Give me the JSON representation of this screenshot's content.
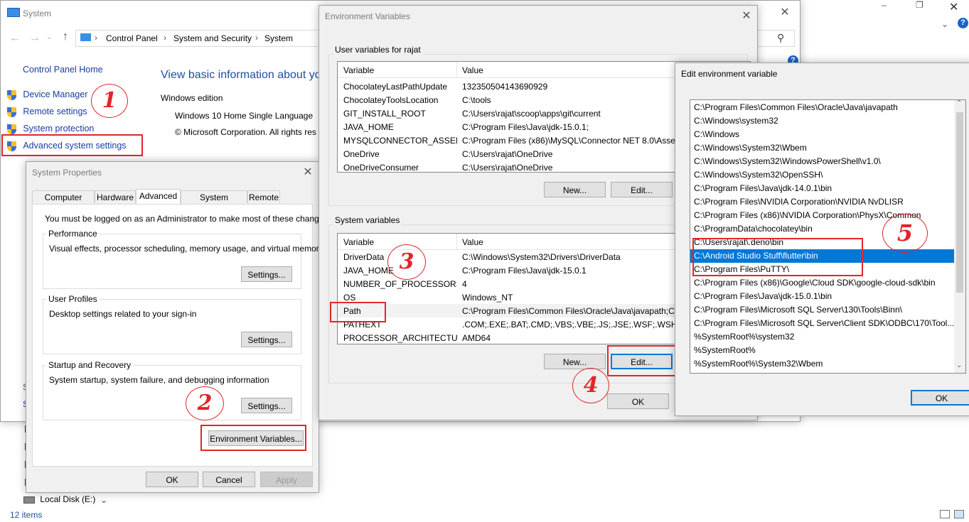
{
  "system_window": {
    "title": "System",
    "breadcrumb": [
      "Control Panel",
      "System and Security",
      "System"
    ],
    "sidebar_home": "Control Panel Home",
    "sidebar_items": [
      "Device Manager",
      "Remote settings",
      "System protection",
      "Advanced system settings"
    ],
    "main_heading": "View basic information about yo",
    "windows_edition_label": "Windows edition",
    "edition_value": "Windows 10 Home Single Language",
    "copyright": "© Microsoft Corporation. All rights res",
    "partial_letters": [
      "S",
      "S"
    ]
  },
  "explorer": {
    "drive_label": "Local Disk (E:)",
    "status_items": "12 items"
  },
  "system_properties": {
    "title": "System Properties",
    "tabs": [
      "Computer Name",
      "Hardware",
      "Advanced",
      "System Protection",
      "Remote"
    ],
    "active_tab": "Advanced",
    "admin_note": "You must be logged on as an Administrator to make most of these changes.",
    "performance": {
      "label": "Performance",
      "desc": "Visual effects, processor scheduling, memory usage, and virtual memory",
      "button": "Settings..."
    },
    "user_profiles": {
      "label": "User Profiles",
      "desc": "Desktop settings related to your sign-in",
      "button": "Settings..."
    },
    "startup": {
      "label": "Startup and Recovery",
      "desc": "System startup, system failure, and debugging information",
      "button": "Settings..."
    },
    "env_button": "Environment Variables...",
    "ok": "OK",
    "cancel": "Cancel",
    "apply": "Apply"
  },
  "env_vars": {
    "title": "Environment Variables",
    "user_group": "User variables for rajat",
    "system_group": "System variables",
    "col_variable": "Variable",
    "col_value": "Value",
    "user_rows": [
      {
        "name": "ChocolateyLastPathUpdate",
        "value": "132350504143690929"
      },
      {
        "name": "ChocolateyToolsLocation",
        "value": "C:\\tools"
      },
      {
        "name": "GIT_INSTALL_ROOT",
        "value": "C:\\Users\\rajat\\scoop\\apps\\git\\current"
      },
      {
        "name": "JAVA_HOME",
        "value": "C:\\Program Files\\Java\\jdk-15.0.1;"
      },
      {
        "name": "MYSQLCONNECTOR_ASSEM...",
        "value": "C:\\Program Files (x86)\\MySQL\\Connector NET 8.0\\Assem"
      },
      {
        "name": "OneDrive",
        "value": "C:\\Users\\rajat\\OneDrive"
      },
      {
        "name": "OneDriveConsumer",
        "value": "C:\\Users\\rajat\\OneDrive"
      }
    ],
    "system_rows": [
      {
        "name": "DriverData",
        "value": "C:\\Windows\\System32\\Drivers\\DriverData"
      },
      {
        "name": "JAVA_HOME",
        "value": "C:\\Program Files\\Java\\jdk-15.0.1"
      },
      {
        "name": "NUMBER_OF_PROCESSORS",
        "value": "4"
      },
      {
        "name": "OS",
        "value": "Windows_NT"
      },
      {
        "name": "Path",
        "value": "C:\\Program Files\\Common Files\\Oracle\\Java\\javapath;C:"
      },
      {
        "name": "PATHEXT",
        "value": ".COM;.EXE;.BAT;.CMD;.VBS;.VBE;.JS;.JSE;.WSF;.WSH;.MSC"
      },
      {
        "name": "PROCESSOR_ARCHITECTURE",
        "value": "AMD64"
      }
    ],
    "new_btn": "New...",
    "edit_btn": "Edit...",
    "ok": "OK"
  },
  "edit_env": {
    "title": "Edit environment variable",
    "items": [
      "C:\\Program Files\\Common Files\\Oracle\\Java\\javapath",
      "C:\\Windows\\system32",
      "C:\\Windows",
      "C:\\Windows\\System32\\Wbem",
      "C:\\Windows\\System32\\WindowsPowerShell\\v1.0\\",
      "C:\\Windows\\System32\\OpenSSH\\",
      "C:\\Program Files\\Java\\jdk-14.0.1\\bin",
      "C:\\Program Files\\NVIDIA Corporation\\NVIDIA NvDLISR",
      "C:\\Program Files (x86)\\NVIDIA Corporation\\PhysX\\Common",
      "C:\\ProgramData\\chocolatey\\bin",
      "C:\\Users\\rajat\\.deno\\bin",
      "C:\\Android Studio Stuff\\flutter\\bin",
      "C:\\Program Files\\PuTTY\\",
      "C:\\Program Files (x86)\\Google\\Cloud SDK\\google-cloud-sdk\\bin",
      "C:\\Program Files\\Java\\jdk-15.0.1\\bin",
      "C:\\Program Files\\Microsoft SQL Server\\130\\Tools\\Binn\\",
      "C:\\Program Files\\Microsoft SQL Server\\Client SDK\\ODBC\\170\\Tool...",
      "%SystemRoot%\\system32",
      "%SystemRoot%",
      "%SystemRoot%\\System32\\Wbem"
    ],
    "selected_item": "C:\\Android Studio Stuff\\flutter\\bin",
    "ok": "OK"
  },
  "annotations": [
    "1",
    "2",
    "3",
    "4",
    "5"
  ],
  "colors": {
    "accent": "#0078d7",
    "annotation_red": "#e0262b",
    "link": "#1a3d9e"
  }
}
